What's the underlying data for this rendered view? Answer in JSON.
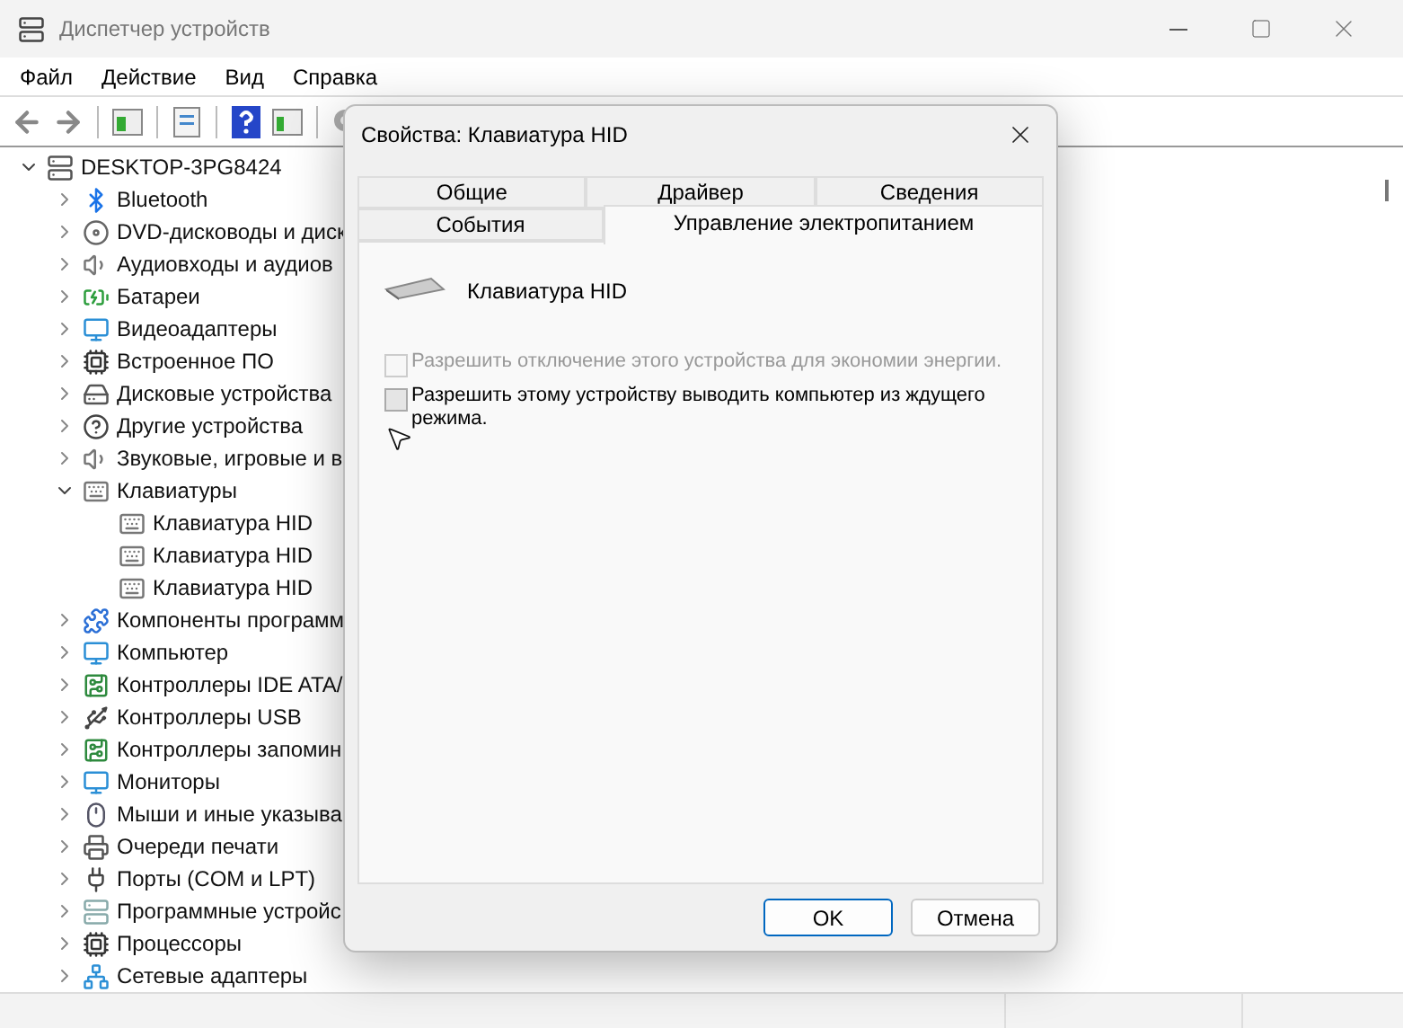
{
  "window": {
    "title": "Диспетчер устройств"
  },
  "menu": [
    "Файл",
    "Действие",
    "Вид",
    "Справка"
  ],
  "tree": {
    "label": "DESKTOP-3PG8424",
    "kind": "computer-root",
    "expanded": true,
    "children": [
      {
        "label": "Bluetooth",
        "kind": "bluetooth",
        "expanded": false
      },
      {
        "label": "DVD-дисководы и диск",
        "kind": "dvd",
        "expanded": false
      },
      {
        "label": "Аудиовходы и аудиов",
        "kind": "speaker",
        "expanded": false
      },
      {
        "label": "Батареи",
        "kind": "battery",
        "expanded": false
      },
      {
        "label": "Видеоадаптеры",
        "kind": "display",
        "expanded": false
      },
      {
        "label": "Встроенное ПО",
        "kind": "chip",
        "expanded": false
      },
      {
        "label": "Дисковые устройства",
        "kind": "drive",
        "expanded": false
      },
      {
        "label": "Другие устройства",
        "kind": "unknown",
        "expanded": false
      },
      {
        "label": "Звуковые, игровые и в",
        "kind": "speaker",
        "expanded": false
      },
      {
        "label": "Клавиатуры",
        "kind": "keyboard",
        "expanded": true,
        "children": [
          {
            "label": "Клавиатура HID",
            "kind": "keyboard"
          },
          {
            "label": "Клавиатура HID",
            "kind": "keyboard"
          },
          {
            "label": "Клавиатура HID",
            "kind": "keyboard"
          }
        ]
      },
      {
        "label": "Компоненты программ",
        "kind": "component",
        "expanded": false
      },
      {
        "label": "Компьютер",
        "kind": "display",
        "expanded": false
      },
      {
        "label": "Контроллеры IDE ATA/",
        "kind": "board",
        "expanded": false
      },
      {
        "label": "Контроллеры USB",
        "kind": "usb",
        "expanded": false
      },
      {
        "label": "Контроллеры запомин",
        "kind": "board",
        "expanded": false
      },
      {
        "label": "Мониторы",
        "kind": "display",
        "expanded": false
      },
      {
        "label": "Мыши и иные указыва",
        "kind": "mouse",
        "expanded": false
      },
      {
        "label": "Очереди печати",
        "kind": "printer",
        "expanded": false
      },
      {
        "label": "Порты (COM и LPT)",
        "kind": "port",
        "expanded": false
      },
      {
        "label": "Программные устройс",
        "kind": "tower",
        "expanded": false
      },
      {
        "label": "Процессоры",
        "kind": "chip",
        "expanded": false
      },
      {
        "label": "Сетевые адаптеры",
        "kind": "network",
        "expanded": false
      }
    ]
  },
  "dialog": {
    "title": "Свойства: Клавиатура HID",
    "tab_rows": [
      [
        {
          "label": "Общие",
          "selected": false
        },
        {
          "label": "Драйвер",
          "selected": false
        },
        {
          "label": "Сведения",
          "selected": false
        }
      ],
      [
        {
          "label": "События",
          "selected": false
        },
        {
          "label": "Управление электропитанием",
          "selected": true
        }
      ]
    ],
    "device_name": "Клавиатура HID",
    "options": [
      {
        "label": "Разрешить отключение этого устройства для экономии энергии.",
        "checked": false,
        "disabled": true
      },
      {
        "label": "Разрешить этому устройству выводить компьютер из ждущего режима.",
        "checked": false,
        "disabled": false
      }
    ],
    "buttons": [
      {
        "label": "OK",
        "default": true
      },
      {
        "label": "Отмена",
        "default": false
      }
    ]
  }
}
